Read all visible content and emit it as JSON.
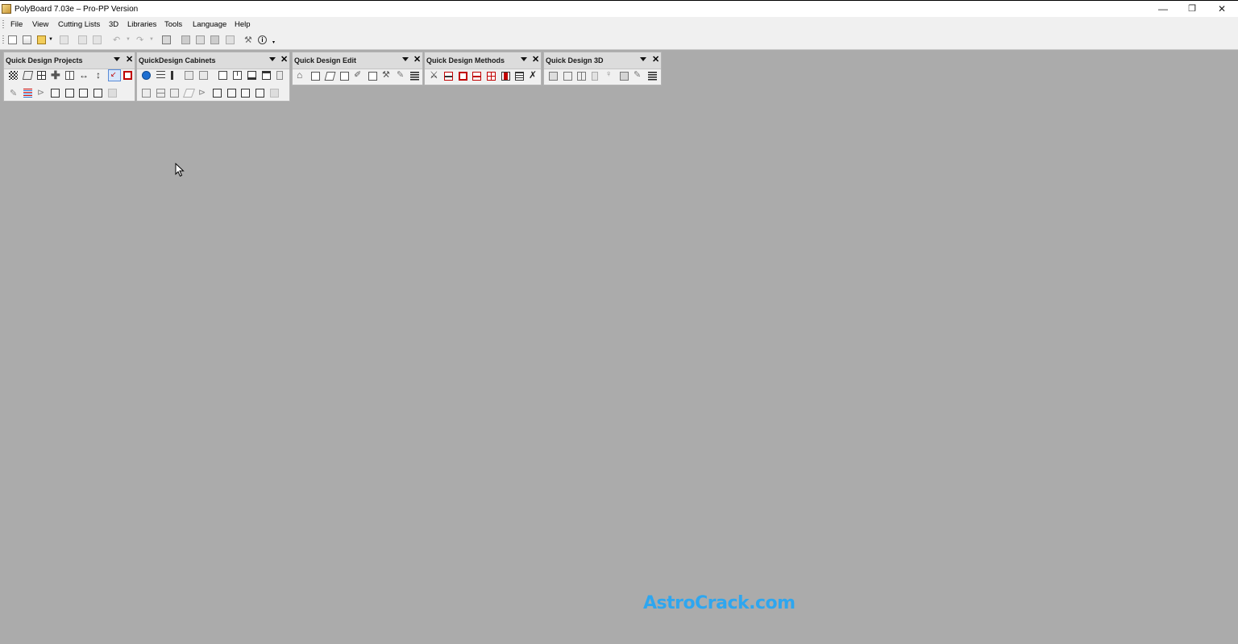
{
  "window": {
    "title": "PolyBoard 7.03e – Pro-PP Version",
    "minimize": "—",
    "restore": "❐",
    "close": "✕"
  },
  "menu": [
    "File",
    "View",
    "Cutting Lists",
    "3D",
    "Libraries",
    "Tools",
    "Language",
    "Help"
  ],
  "toolbar": {
    "icons": [
      "new-project-icon",
      "duplicate-icon",
      "open-folder-icon",
      "save-icon",
      "print-icon",
      "print-preview-icon",
      "undo-icon",
      "redo-icon",
      "export-icon",
      "view-3d-icon",
      "copy-view-icon",
      "layers-icon",
      "rotate-icon",
      "wrench-icon",
      "info-icon"
    ]
  },
  "panels": [
    {
      "title": "Quick Design Projects"
    },
    {
      "title": "QuickDesign Cabinets"
    },
    {
      "title": "Quick Design Edit"
    },
    {
      "title": "Quick Design Methods"
    },
    {
      "title": "Quick Design 3D"
    }
  ],
  "watermark": "AstroCrack.com",
  "colors": {
    "workspace": "#ababab",
    "accent_red": "#c00000",
    "accent_blue": "#1f6fd1",
    "watermark": "#2ea6ef"
  }
}
